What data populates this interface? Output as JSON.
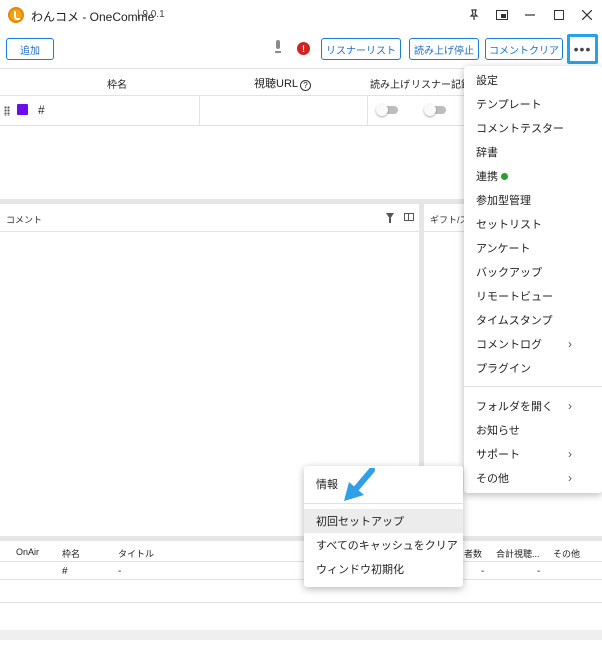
{
  "titlebar": {
    "title": "わんコメ - OneComme",
    "separator": "|",
    "version": "9.0.1",
    "icons": [
      "pin-icon",
      "picture-in-picture-icon",
      "minimize-icon",
      "maximize-icon",
      "close-icon"
    ]
  },
  "toolbar": {
    "add_label": "追加",
    "listener_list_label": "リスナーリスト",
    "stop_reading_label": "読み上げ停止",
    "clear_comments_label": "コメントクリア",
    "more_label": "•••",
    "alert_glyph": "!"
  },
  "frame_table": {
    "headers": {
      "name": "枠名",
      "url": "視聴URL",
      "reading": "読み上げ",
      "listener_log": "リスナー記録"
    },
    "help_glyph": "?",
    "rows": [
      {
        "color": "#6a0dea",
        "name": "#"
      }
    ]
  },
  "comment_pane": {
    "title": "コメント",
    "gift_title": "ギフト/ス"
  },
  "main_menu": {
    "items": [
      {
        "label": "設定"
      },
      {
        "label": "テンプレート"
      },
      {
        "label": "コメントテスター"
      },
      {
        "label": "辞書"
      },
      {
        "label": "連携"
      },
      {
        "label": "参加型管理"
      },
      {
        "label": "セットリスト"
      },
      {
        "label": "アンケート"
      },
      {
        "label": "バックアップ"
      },
      {
        "label": "リモートビュー"
      },
      {
        "label": "タイムスタンプ"
      },
      {
        "label": "コメントログ"
      },
      {
        "label": "プラグイン"
      },
      {
        "label": "フォルダを開く"
      },
      {
        "label": "お知らせ"
      },
      {
        "label": "サポート"
      },
      {
        "label": "その他"
      }
    ],
    "chevron": "›",
    "status_color": "#2e9b2e"
  },
  "submenu": {
    "items": [
      {
        "label": "情報"
      },
      {
        "label": "初回セットアップ"
      },
      {
        "label": "すべてのキャッシュをクリア"
      },
      {
        "label": "ウィンドウ初期化"
      }
    ]
  },
  "bottom_table": {
    "headers": [
      "OnAir",
      "枠名",
      "タイトル",
      "者数",
      "合計視聴...",
      "その他"
    ],
    "row": [
      "#",
      "-",
      "-",
      "-"
    ]
  },
  "colors": {
    "accent": "#1f7ad8",
    "highlight_border": "#2aa0ea",
    "alert": "#d32222",
    "arrow": "#2f9fe8"
  }
}
